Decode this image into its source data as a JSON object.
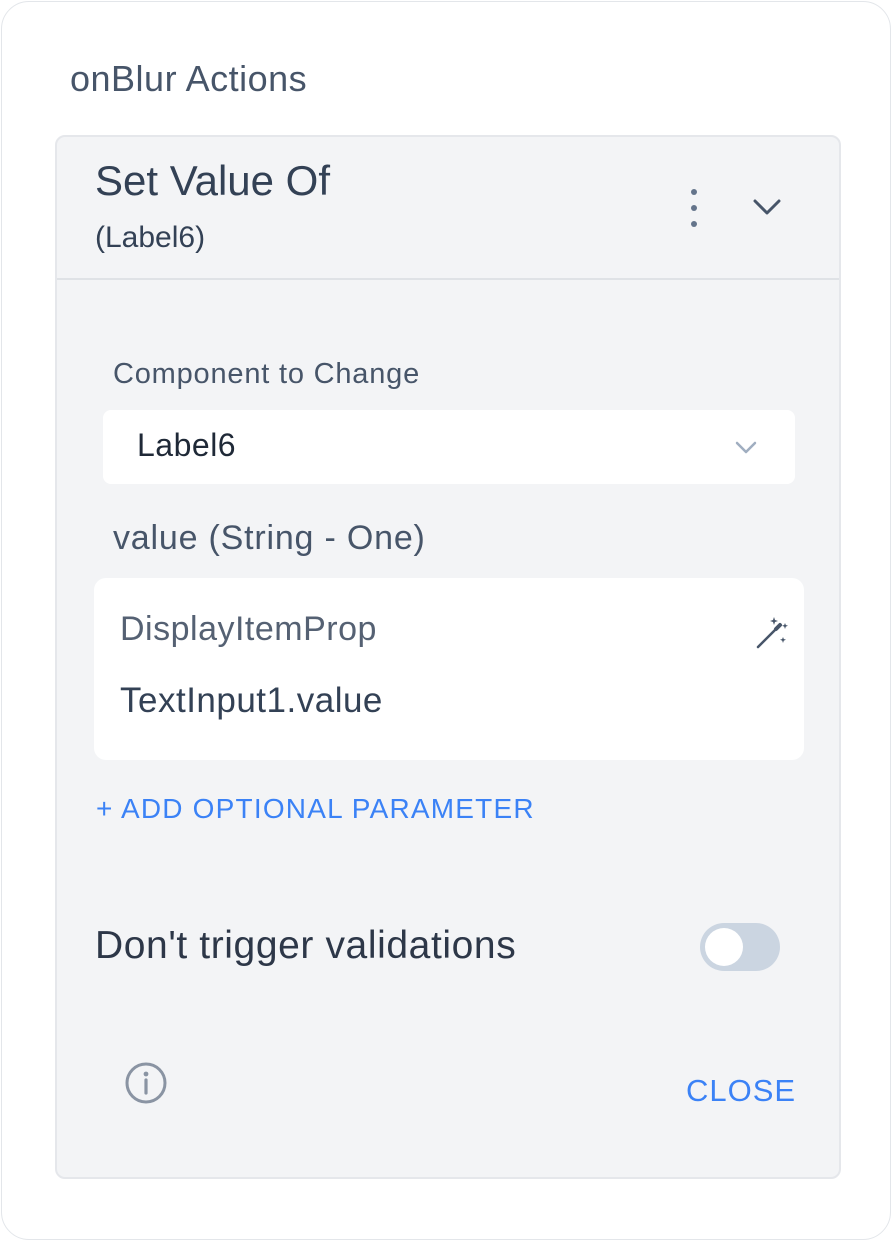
{
  "section": {
    "title": "onBlur Actions"
  },
  "action": {
    "title": "Set Value Of",
    "subtitle": "(Label6)"
  },
  "component_field": {
    "label": "Component to Change",
    "value": "Label6"
  },
  "value_field": {
    "label": "value (String - One)",
    "prop_name": "DisplayItemProp",
    "prop_value": "TextInput1.value"
  },
  "add_param": {
    "label": "+ ADD OPTIONAL PARAMETER"
  },
  "validations": {
    "label": "Don't trigger validations",
    "enabled": false
  },
  "footer": {
    "close_label": "CLOSE"
  },
  "colors": {
    "accent": "#3b82f6",
    "card_bg": "#f3f4f6",
    "toggle_off": "#cbd5e1"
  },
  "icons": [
    "more-vertical-icon",
    "chevron-down-icon",
    "magic-wand-icon",
    "info-icon"
  ]
}
